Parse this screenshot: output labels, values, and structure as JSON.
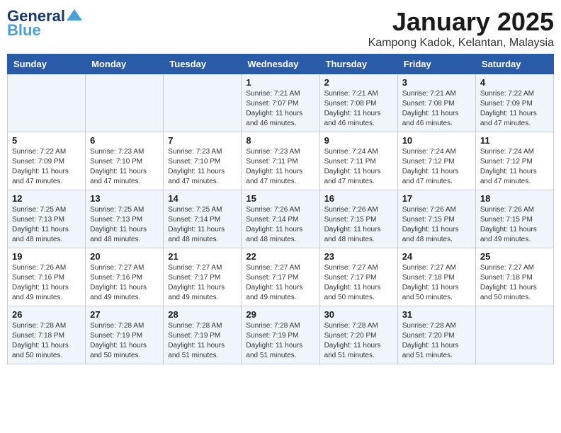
{
  "header": {
    "logo_line1": "General",
    "logo_line2": "Blue",
    "month": "January 2025",
    "location": "Kampong Kadok, Kelantan, Malaysia"
  },
  "weekdays": [
    "Sunday",
    "Monday",
    "Tuesday",
    "Wednesday",
    "Thursday",
    "Friday",
    "Saturday"
  ],
  "weeks": [
    [
      {
        "day": "",
        "info": ""
      },
      {
        "day": "",
        "info": ""
      },
      {
        "day": "",
        "info": ""
      },
      {
        "day": "1",
        "info": "Sunrise: 7:21 AM\nSunset: 7:07 PM\nDaylight: 11 hours\nand 46 minutes."
      },
      {
        "day": "2",
        "info": "Sunrise: 7:21 AM\nSunset: 7:08 PM\nDaylight: 11 hours\nand 46 minutes."
      },
      {
        "day": "3",
        "info": "Sunrise: 7:21 AM\nSunset: 7:08 PM\nDaylight: 11 hours\nand 46 minutes."
      },
      {
        "day": "4",
        "info": "Sunrise: 7:22 AM\nSunset: 7:09 PM\nDaylight: 11 hours\nand 47 minutes."
      }
    ],
    [
      {
        "day": "5",
        "info": "Sunrise: 7:22 AM\nSunset: 7:09 PM\nDaylight: 11 hours\nand 47 minutes."
      },
      {
        "day": "6",
        "info": "Sunrise: 7:23 AM\nSunset: 7:10 PM\nDaylight: 11 hours\nand 47 minutes."
      },
      {
        "day": "7",
        "info": "Sunrise: 7:23 AM\nSunset: 7:10 PM\nDaylight: 11 hours\nand 47 minutes."
      },
      {
        "day": "8",
        "info": "Sunrise: 7:23 AM\nSunset: 7:11 PM\nDaylight: 11 hours\nand 47 minutes."
      },
      {
        "day": "9",
        "info": "Sunrise: 7:24 AM\nSunset: 7:11 PM\nDaylight: 11 hours\nand 47 minutes."
      },
      {
        "day": "10",
        "info": "Sunrise: 7:24 AM\nSunset: 7:12 PM\nDaylight: 11 hours\nand 47 minutes."
      },
      {
        "day": "11",
        "info": "Sunrise: 7:24 AM\nSunset: 7:12 PM\nDaylight: 11 hours\nand 47 minutes."
      }
    ],
    [
      {
        "day": "12",
        "info": "Sunrise: 7:25 AM\nSunset: 7:13 PM\nDaylight: 11 hours\nand 48 minutes."
      },
      {
        "day": "13",
        "info": "Sunrise: 7:25 AM\nSunset: 7:13 PM\nDaylight: 11 hours\nand 48 minutes."
      },
      {
        "day": "14",
        "info": "Sunrise: 7:25 AM\nSunset: 7:14 PM\nDaylight: 11 hours\nand 48 minutes."
      },
      {
        "day": "15",
        "info": "Sunrise: 7:26 AM\nSunset: 7:14 PM\nDaylight: 11 hours\nand 48 minutes."
      },
      {
        "day": "16",
        "info": "Sunrise: 7:26 AM\nSunset: 7:15 PM\nDaylight: 11 hours\nand 48 minutes."
      },
      {
        "day": "17",
        "info": "Sunrise: 7:26 AM\nSunset: 7:15 PM\nDaylight: 11 hours\nand 48 minutes."
      },
      {
        "day": "18",
        "info": "Sunrise: 7:26 AM\nSunset: 7:15 PM\nDaylight: 11 hours\nand 49 minutes."
      }
    ],
    [
      {
        "day": "19",
        "info": "Sunrise: 7:26 AM\nSunset: 7:16 PM\nDaylight: 11 hours\nand 49 minutes."
      },
      {
        "day": "20",
        "info": "Sunrise: 7:27 AM\nSunset: 7:16 PM\nDaylight: 11 hours\nand 49 minutes."
      },
      {
        "day": "21",
        "info": "Sunrise: 7:27 AM\nSunset: 7:17 PM\nDaylight: 11 hours\nand 49 minutes."
      },
      {
        "day": "22",
        "info": "Sunrise: 7:27 AM\nSunset: 7:17 PM\nDaylight: 11 hours\nand 49 minutes."
      },
      {
        "day": "23",
        "info": "Sunrise: 7:27 AM\nSunset: 7:17 PM\nDaylight: 11 hours\nand 50 minutes."
      },
      {
        "day": "24",
        "info": "Sunrise: 7:27 AM\nSunset: 7:18 PM\nDaylight: 11 hours\nand 50 minutes."
      },
      {
        "day": "25",
        "info": "Sunrise: 7:27 AM\nSunset: 7:18 PM\nDaylight: 11 hours\nand 50 minutes."
      }
    ],
    [
      {
        "day": "26",
        "info": "Sunrise: 7:28 AM\nSunset: 7:18 PM\nDaylight: 11 hours\nand 50 minutes."
      },
      {
        "day": "27",
        "info": "Sunrise: 7:28 AM\nSunset: 7:19 PM\nDaylight: 11 hours\nand 50 minutes."
      },
      {
        "day": "28",
        "info": "Sunrise: 7:28 AM\nSunset: 7:19 PM\nDaylight: 11 hours\nand 51 minutes."
      },
      {
        "day": "29",
        "info": "Sunrise: 7:28 AM\nSunset: 7:19 PM\nDaylight: 11 hours\nand 51 minutes."
      },
      {
        "day": "30",
        "info": "Sunrise: 7:28 AM\nSunset: 7:20 PM\nDaylight: 11 hours\nand 51 minutes."
      },
      {
        "day": "31",
        "info": "Sunrise: 7:28 AM\nSunset: 7:20 PM\nDaylight: 11 hours\nand 51 minutes."
      },
      {
        "day": "",
        "info": ""
      }
    ]
  ]
}
